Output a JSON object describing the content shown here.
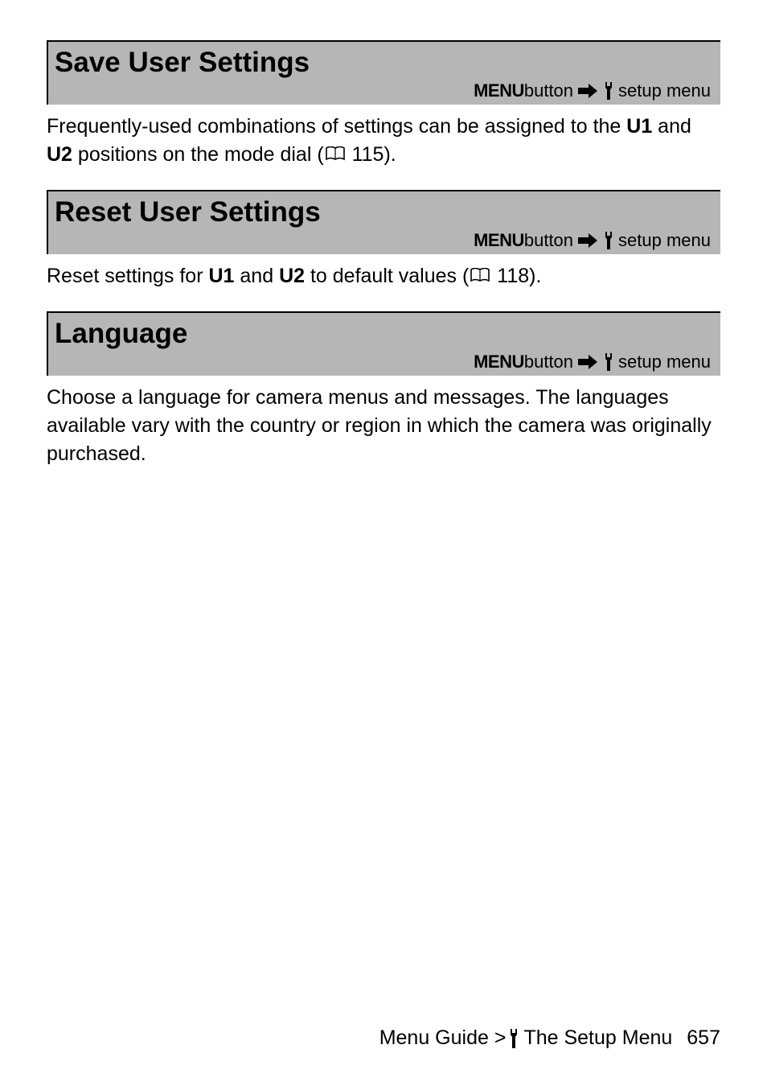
{
  "nav": {
    "menu_label": "MENU",
    "button_word": " button ",
    "setup_menu": " setup menu"
  },
  "sections": [
    {
      "title": "Save User Settings",
      "body_pre": "Frequently-used combinations of settings can be assigned to the ",
      "b1": "U1",
      "mid": " and ",
      "b2": "U2",
      "body_post": " positions on the mode dial (",
      "page_ref": " 115).",
      "has_ref": true
    },
    {
      "title": "Reset User Settings",
      "body_pre": "Reset settings for ",
      "b1": "U1",
      "mid": " and ",
      "b2": "U2",
      "body_post": " to default values (",
      "page_ref": " 118).",
      "has_ref": true
    },
    {
      "title": "Language",
      "body_pre": "Choose a language for camera menus and messages. The languages available vary with the country or region in which the camera was originally purchased.",
      "b1": "",
      "mid": "",
      "b2": "",
      "body_post": "",
      "page_ref": "",
      "has_ref": false
    }
  ],
  "footer": {
    "breadcrumb_pre": "Menu Guide > ",
    "breadcrumb_post": " The Setup Menu",
    "page_number": "657"
  }
}
